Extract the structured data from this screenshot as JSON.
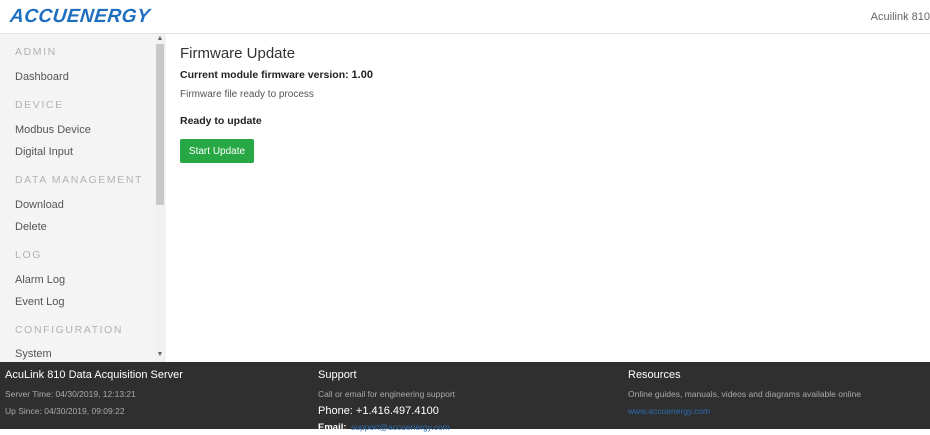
{
  "header": {
    "logo_text": "ACCUENERGY",
    "user_text": "Acuilink 810"
  },
  "sidebar": {
    "sections": [
      {
        "heading": "ADMIN",
        "items": [
          "Dashboard"
        ]
      },
      {
        "heading": "DEVICE",
        "items": [
          "Modbus Device",
          "Digital Input"
        ]
      },
      {
        "heading": "DATA MANAGEMENT",
        "items": [
          "Download",
          "Delete"
        ]
      },
      {
        "heading": "LOG",
        "items": [
          "Alarm Log",
          "Event Log"
        ]
      },
      {
        "heading": "CONFIGURATION",
        "items": [
          "System"
        ]
      }
    ],
    "scroll_up_icon": "triangle-up-icon",
    "scroll_down_icon": "triangle-down-icon"
  },
  "main": {
    "title": "Firmware Update",
    "version_label": "Current module firmware version:",
    "version_value": "1.00",
    "status_text": "Firmware file ready to process",
    "ready_text": "Ready to update",
    "start_button": "Start Update"
  },
  "footer": {
    "server": {
      "title": "AcuLink 810 Data Acquisition Server",
      "server_time": "Server Time: 04/30/2019, 12:13:21",
      "up_since": "Up Since: 04/30/2019, 09:09:22"
    },
    "support": {
      "title": "Support",
      "subtitle": "Call or email for engineering support",
      "phone": "Phone: +1.416.497.4100",
      "email_label": "Email:",
      "email": "support@accuenergy.com"
    },
    "resources": {
      "title": "Resources",
      "subtitle": "Online guides, manuals, videos and diagrams available online",
      "link": "www.accuenergy.com"
    }
  },
  "colors": {
    "brand": "#1f6fc1",
    "button": "#28a745",
    "footer_bg": "#2f2f2f",
    "sidebar_bg": "#f4f4f4"
  }
}
